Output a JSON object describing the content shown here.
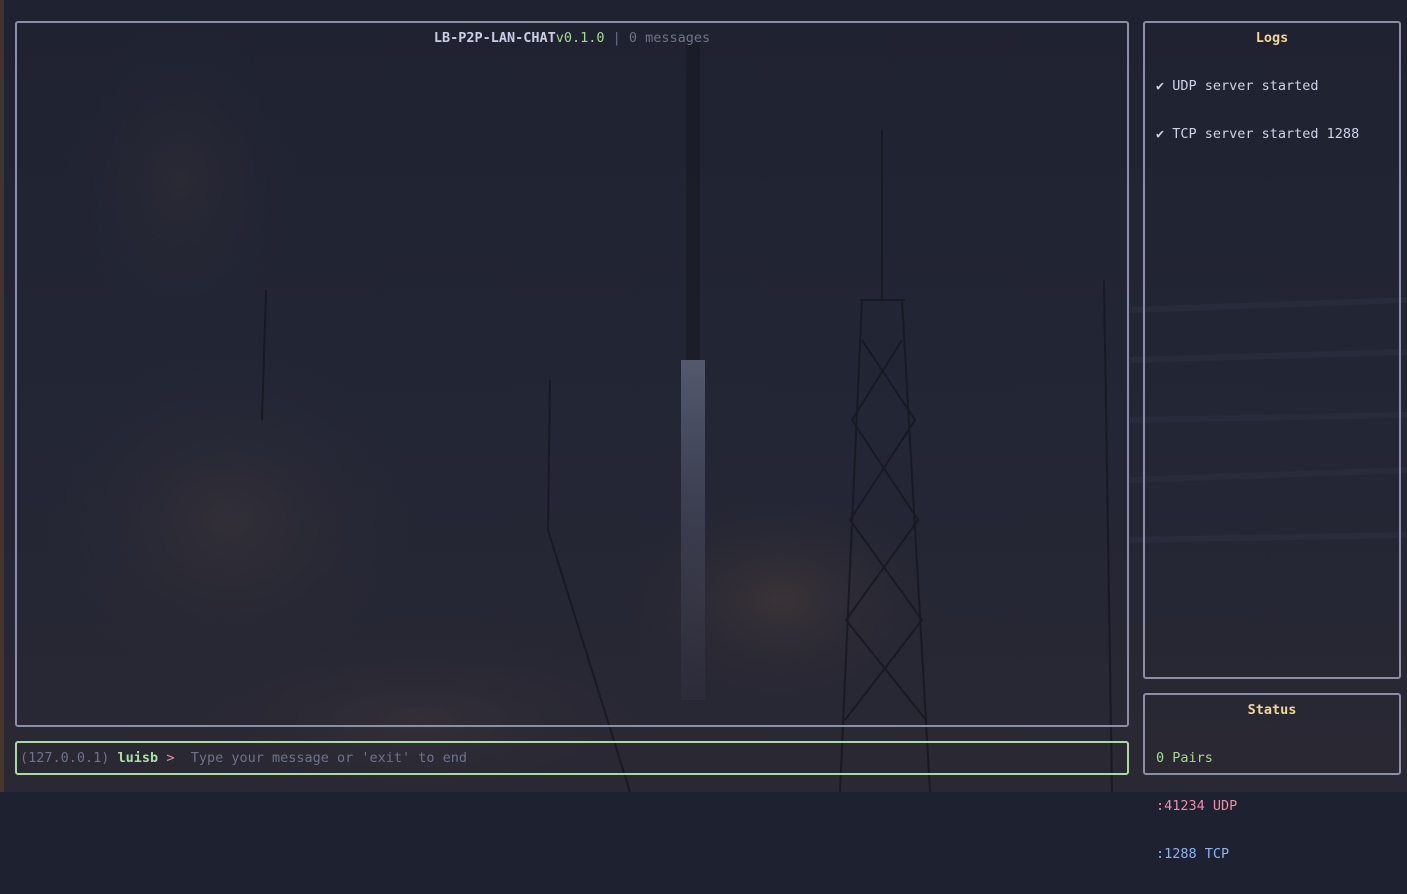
{
  "chat": {
    "app_name": "LB-P2P-LAN-CHAT",
    "version": "v0.1.0",
    "separator": " | ",
    "message_count": "0 messages"
  },
  "logs": {
    "title": "Logs",
    "entries": [
      "✔ UDP server started",
      "✔ TCP server started 1288"
    ]
  },
  "status": {
    "title": "Status",
    "pairs": "0 Pairs",
    "udp_port": ":41234 UDP",
    "tcp_colon": ":",
    "tcp_port": "1288",
    "tcp_proto": " TCP"
  },
  "input": {
    "ip": "(127.0.0.1)",
    "user": "luisb",
    "prompt": " > ",
    "placeholder": "Type your message or 'exit' to end",
    "value": ""
  },
  "colors": {
    "background": "#1e2130",
    "border": "#8a8fa6",
    "input_border": "#a9dc9a",
    "accent_green": "#a6d98c",
    "accent_pink": "#f08ca6",
    "accent_blue": "#8ab4f8",
    "title_yellow": "#f5d68f"
  },
  "wallpaper": "rocket-launch-background-image"
}
